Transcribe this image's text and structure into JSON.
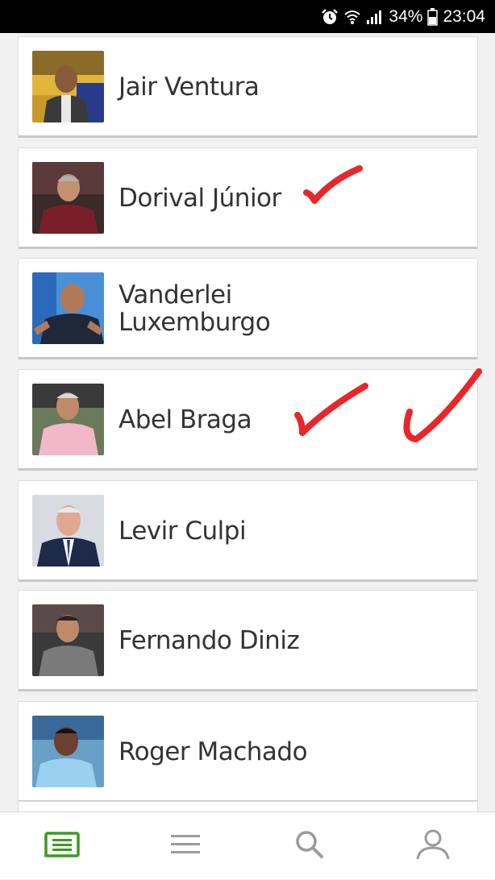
{
  "status_bar": {
    "battery": "34%",
    "time": "23:04",
    "icons": [
      "alarm-icon",
      "wifi-icon",
      "signal-icon",
      "battery-icon"
    ]
  },
  "coaches": [
    {
      "name": "Jair Ventura"
    },
    {
      "name": "Dorival Júnior"
    },
    {
      "name": "Vanderlei Luxemburgo"
    },
    {
      "name": "Abel Braga"
    },
    {
      "name": "Levir Culpi"
    },
    {
      "name": "Fernando Diniz"
    },
    {
      "name": "Roger Machado"
    }
  ],
  "colors": {
    "accent_green": "#3a9c1f",
    "checkmark_red": "#e8262b",
    "text": "#333333",
    "nav_icon_gray": "#9a9a9a"
  },
  "bottom_nav": {
    "items": [
      "news-icon",
      "menu-icon",
      "search-icon",
      "profile-icon"
    ],
    "active": "news-icon"
  }
}
